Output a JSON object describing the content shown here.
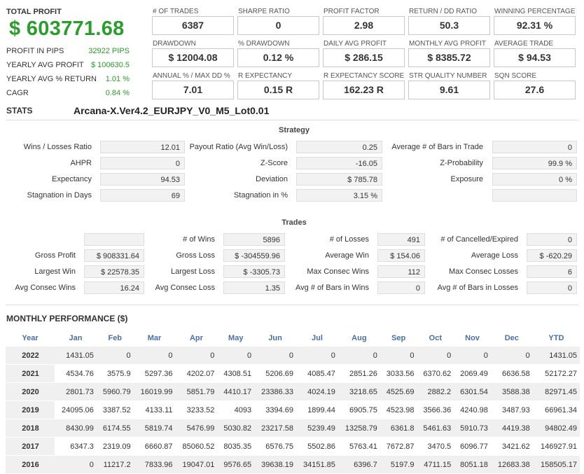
{
  "summary": {
    "total_profit_label": "TOTAL PROFIT",
    "total_profit_value": "$ 603771.68",
    "rows": [
      {
        "label": "PROFIT IN PIPS",
        "value": "32922 PIPS"
      },
      {
        "label": "YEARLY AVG PROFIT",
        "value": "$ 100630.5"
      },
      {
        "label": "YEARLY AVG % RETURN",
        "value": "1.01 %"
      },
      {
        "label": "CAGR",
        "value": "0.84 %"
      }
    ]
  },
  "metrics": [
    {
      "label": "# OF TRADES",
      "value": "6387"
    },
    {
      "label": "SHARPE RATIO",
      "value": "0"
    },
    {
      "label": "PROFIT FACTOR",
      "value": "2.98"
    },
    {
      "label": "RETURN / DD RATIO",
      "value": "50.3"
    },
    {
      "label": "WINNING PERCENTAGE",
      "value": "92.31 %"
    },
    {
      "label": "DRAWDOWN",
      "value": "$ 12004.08"
    },
    {
      "label": "% DRAWDOWN",
      "value": "0.12 %"
    },
    {
      "label": "DAILY AVG PROFIT",
      "value": "$ 286.15"
    },
    {
      "label": "MONTHLY AVG PROFIT",
      "value": "$ 8385.72"
    },
    {
      "label": "AVERAGE TRADE",
      "value": "$ 94.53"
    },
    {
      "label": "ANNUAL % / MAX DD %",
      "value": "7.01"
    },
    {
      "label": "R EXPECTANCY",
      "value": "0.15 R"
    },
    {
      "label": "R EXPECTANCY SCORE",
      "value": "162.23 R"
    },
    {
      "label": "STR QUALITY NUMBER",
      "value": "9.61"
    },
    {
      "label": "SQN SCORE",
      "value": "27.6"
    }
  ],
  "stats": {
    "label": "STATS",
    "strategy_name": "Arcana-X.Ver4.2_EURJPY_V0_M5_Lot0.01"
  },
  "strategy": {
    "title": "Strategy",
    "rows": [
      [
        {
          "label": "Wins / Losses Ratio",
          "value": "12.01"
        },
        {
          "label": "Payout Ratio (Avg Win/Loss)",
          "value": "0.25"
        },
        {
          "label": "Average # of Bars in Trade",
          "value": "0"
        }
      ],
      [
        {
          "label": "AHPR",
          "value": "0"
        },
        {
          "label": "Z-Score",
          "value": "-16.05"
        },
        {
          "label": "Z-Probability",
          "value": "99.9 %"
        }
      ],
      [
        {
          "label": "Expectancy",
          "value": "94.53"
        },
        {
          "label": "Deviation",
          "value": "$ 785.78"
        },
        {
          "label": "Exposure",
          "value": "0 %"
        }
      ],
      [
        {
          "label": "Stagnation in Days",
          "value": "69"
        },
        {
          "label": "Stagnation in %",
          "value": "3.15 %"
        },
        {
          "label": "",
          "value": ""
        }
      ]
    ]
  },
  "trades": {
    "title": "Trades",
    "rows": [
      [
        {
          "label": "",
          "value": ""
        },
        {
          "label": "# of Wins",
          "value": "5896"
        },
        {
          "label": "# of Losses",
          "value": "491"
        },
        {
          "label": "# of Cancelled/Expired",
          "value": "0"
        }
      ],
      [
        {
          "label": "Gross Profit",
          "value": "$ 908331.64"
        },
        {
          "label": "Gross Loss",
          "value": "$ -304559.96"
        },
        {
          "label": "Average Win",
          "value": "$ 154.06"
        },
        {
          "label": "Average Loss",
          "value": "$ -620.29"
        }
      ],
      [
        {
          "label": "Largest Win",
          "value": "$ 22578.35"
        },
        {
          "label": "Largest Loss",
          "value": "$ -3305.73"
        },
        {
          "label": "Max Consec Wins",
          "value": "112"
        },
        {
          "label": "Max Consec Losses",
          "value": "6"
        }
      ],
      [
        {
          "label": "Avg Consec Wins",
          "value": "16.24"
        },
        {
          "label": "Avg Consec Loss",
          "value": "1.35"
        },
        {
          "label": "Avg # of Bars in Wins",
          "value": "0"
        },
        {
          "label": "Avg # of Bars in Losses",
          "value": "0"
        }
      ]
    ]
  },
  "monthly": {
    "title": "MONTHLY PERFORMANCE ($)",
    "headers": [
      "Year",
      "Jan",
      "Feb",
      "Mar",
      "Apr",
      "May",
      "Jun",
      "Jul",
      "Aug",
      "Sep",
      "Oct",
      "Nov",
      "Dec",
      "YTD"
    ],
    "rows": [
      [
        "2022",
        "1431.05",
        "0",
        "0",
        "0",
        "0",
        "0",
        "0",
        "0",
        "0",
        "0",
        "0",
        "0",
        "1431.05"
      ],
      [
        "2021",
        "4534.76",
        "3575.9",
        "5297.36",
        "4202.07",
        "4308.51",
        "5206.69",
        "4085.47",
        "2851.26",
        "3033.56",
        "6370.62",
        "2069.49",
        "6636.58",
        "52172.27"
      ],
      [
        "2020",
        "2801.73",
        "5960.79",
        "16019.99",
        "5851.79",
        "4410.17",
        "23386.33",
        "4024.19",
        "3218.65",
        "4525.69",
        "2882.2",
        "6301.54",
        "3588.38",
        "82971.45"
      ],
      [
        "2019",
        "24095.06",
        "3387.52",
        "4133.11",
        "3233.52",
        "4093",
        "3394.69",
        "1899.44",
        "6905.75",
        "4523.98",
        "3566.36",
        "4240.98",
        "3487.93",
        "66961.34"
      ],
      [
        "2018",
        "8430.99",
        "6174.55",
        "5819.74",
        "5476.99",
        "5030.82",
        "23217.58",
        "5239.49",
        "13258.79",
        "6361.8",
        "5461.63",
        "5910.73",
        "4419.38",
        "94802.49"
      ],
      [
        "2017",
        "6347.3",
        "2319.09",
        "6660.87",
        "85060.52",
        "8035.35",
        "6576.75",
        "5502.86",
        "5763.41",
        "7672.87",
        "3470.5",
        "6096.77",
        "3421.62",
        "146927.91"
      ],
      [
        "2016",
        "0",
        "11217.2",
        "7833.96",
        "19047.01",
        "9576.65",
        "39638.19",
        "34151.85",
        "6396.7",
        "5197.9",
        "4711.15",
        "8051.18",
        "12683.38",
        "158505.17"
      ]
    ]
  }
}
